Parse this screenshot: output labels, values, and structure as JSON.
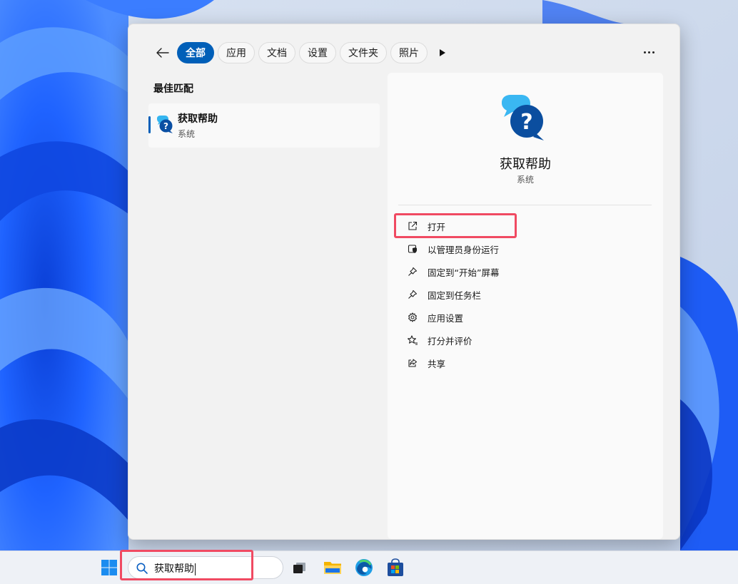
{
  "filters": {
    "back_label": "back",
    "chips": [
      {
        "label": "全部",
        "active": true
      },
      {
        "label": "应用",
        "active": false
      },
      {
        "label": "文档",
        "active": false
      },
      {
        "label": "设置",
        "active": false
      },
      {
        "label": "文件夹",
        "active": false
      },
      {
        "label": "照片",
        "active": false
      }
    ]
  },
  "best_match": {
    "heading": "最佳匹配",
    "name": "获取帮助",
    "type": "系统"
  },
  "detail": {
    "name": "获取帮助",
    "type": "系统",
    "actions": [
      {
        "label": "打开",
        "icon": "open-external-icon"
      },
      {
        "label": "以管理员身份运行",
        "icon": "run-as-admin-icon"
      },
      {
        "label": "固定到“开始”屏幕",
        "icon": "pin-icon"
      },
      {
        "label": "固定到任务栏",
        "icon": "pin-icon"
      },
      {
        "label": "应用设置",
        "icon": "gear-icon"
      },
      {
        "label": "打分并评价",
        "icon": "star-icon"
      },
      {
        "label": "共享",
        "icon": "share-icon"
      }
    ]
  },
  "taskbar": {
    "search_value": "获取帮助"
  },
  "colors": {
    "accent": "#005fb8",
    "highlight": "#f04a62"
  }
}
